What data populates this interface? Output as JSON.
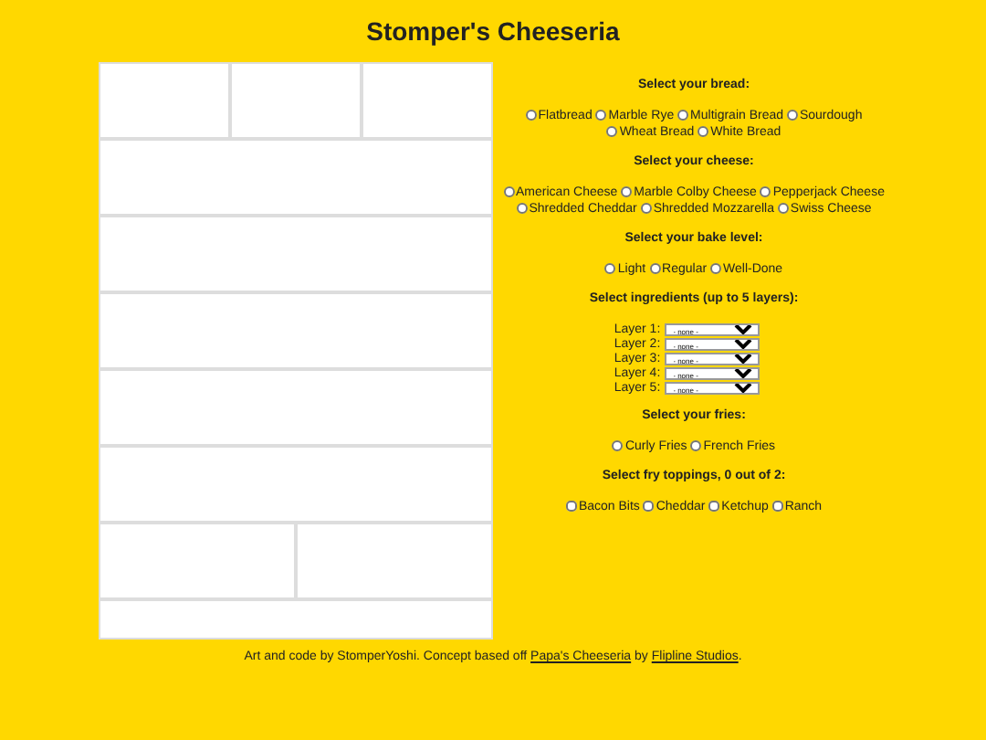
{
  "title": "Stomper's Cheeseria",
  "tile_grid": {
    "rows": [
      {
        "kind": "triple"
      },
      {
        "kind": "full"
      },
      {
        "kind": "full"
      },
      {
        "kind": "full"
      },
      {
        "kind": "full"
      },
      {
        "kind": "full"
      },
      {
        "kind": "double"
      },
      {
        "kind": "short"
      }
    ]
  },
  "sections": [
    {
      "kind": "radio",
      "heading": "Select your bread:",
      "options": [
        {
          "label": "Flatbread",
          "selected": false
        },
        {
          "label": "Marble Rye",
          "selected": false
        },
        {
          "label": "Multigrain Bread",
          "selected": false
        },
        {
          "label": "Sourdough",
          "selected": false
        },
        {
          "label": "Wheat Bread",
          "selected": false
        },
        {
          "label": "White Bread",
          "selected": false
        }
      ]
    },
    {
      "kind": "radio",
      "heading": "Select your cheese:",
      "options": [
        {
          "label": "American Cheese",
          "selected": false
        },
        {
          "label": "Marble Colby Cheese",
          "selected": false
        },
        {
          "label": "Pepperjack Cheese",
          "selected": false
        },
        {
          "label": "Shredded Cheddar",
          "selected": false
        },
        {
          "label": "Shredded Mozzarella",
          "selected": false
        },
        {
          "label": "Swiss Cheese",
          "selected": false
        }
      ]
    },
    {
      "kind": "radio",
      "heading": "Select your bake level:",
      "options": [
        {
          "label": "Light",
          "selected": false
        },
        {
          "label": "Regular",
          "selected": false
        },
        {
          "label": "Well-Done",
          "selected": false
        }
      ]
    },
    {
      "kind": "select",
      "heading": "Select ingredients (up to 5 layers):",
      "layers": [
        {
          "label": "Layer 1:",
          "value": "- none -"
        },
        {
          "label": "Layer 2:",
          "value": "- none -"
        },
        {
          "label": "Layer 3:",
          "value": "- none -"
        },
        {
          "label": "Layer 4:",
          "value": "- none -"
        },
        {
          "label": "Layer 5:",
          "value": "- none -"
        }
      ]
    },
    {
      "kind": "radio",
      "heading": "Select your fries:",
      "options": [
        {
          "label": "Curly Fries",
          "selected": false
        },
        {
          "label": "French Fries",
          "selected": false
        }
      ]
    },
    {
      "kind": "checkbox",
      "heading": "Select fry toppings, 0 out of 2:",
      "options": [
        {
          "label": "Bacon Bits",
          "checked": false
        },
        {
          "label": "Cheddar",
          "checked": false
        },
        {
          "label": "Ketchup",
          "checked": false
        },
        {
          "label": "Ranch",
          "checked": false
        }
      ]
    }
  ],
  "footer": [
    {
      "kind": "text",
      "text": "Art and code by StomperYoshi. Concept based off "
    },
    {
      "kind": "link",
      "text": "Papa's Cheeseria"
    },
    {
      "kind": "text",
      "text": " by "
    },
    {
      "kind": "link",
      "text": "Flipline Studios"
    },
    {
      "kind": "text",
      "text": "."
    }
  ]
}
